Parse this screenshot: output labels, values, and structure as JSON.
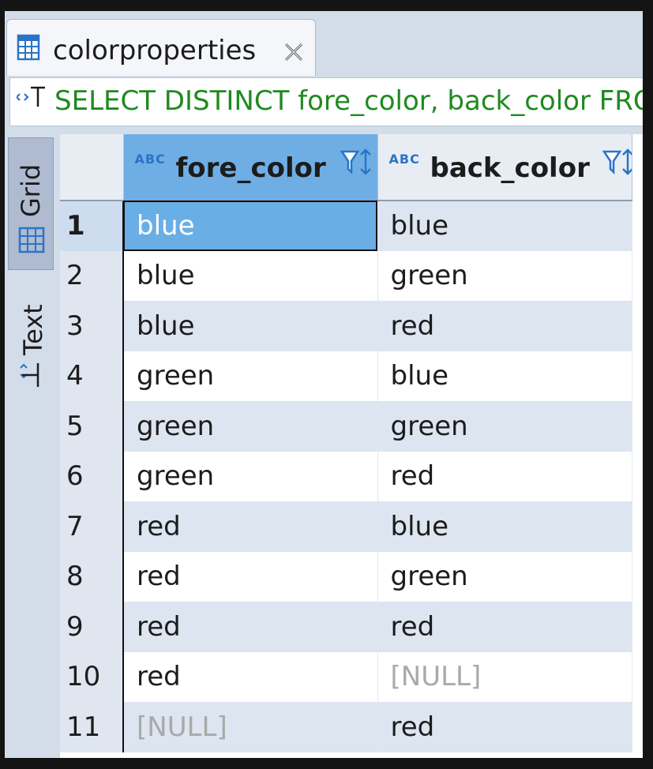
{
  "editor_tab": {
    "title": "colorproperties"
  },
  "query": {
    "sql": "SELECT DISTINCT fore_color, back_color FROM colorproperties"
  },
  "side_tabs": {
    "grid_label": "Grid",
    "text_label": "Text"
  },
  "table": {
    "type_badge": "ABC",
    "columns": [
      "fore_color",
      "back_color"
    ],
    "rows": [
      {
        "num": "1",
        "fore_color": "blue",
        "back_color": "blue"
      },
      {
        "num": "2",
        "fore_color": "blue",
        "back_color": "green"
      },
      {
        "num": "3",
        "fore_color": "blue",
        "back_color": "red"
      },
      {
        "num": "4",
        "fore_color": "green",
        "back_color": "blue"
      },
      {
        "num": "5",
        "fore_color": "green",
        "back_color": "green"
      },
      {
        "num": "6",
        "fore_color": "green",
        "back_color": "red"
      },
      {
        "num": "7",
        "fore_color": "red",
        "back_color": "blue"
      },
      {
        "num": "8",
        "fore_color": "red",
        "back_color": "green"
      },
      {
        "num": "9",
        "fore_color": "red",
        "back_color": "red"
      },
      {
        "num": "10",
        "fore_color": "red",
        "back_color": "[NULL]"
      },
      {
        "num": "11",
        "fore_color": "[NULL]",
        "back_color": "red"
      }
    ]
  },
  "colors": {
    "sql_text": "#1f8a1f",
    "selected_header": "#6faee5",
    "selected_cell": "#6aaee6",
    "null_text": "#a9a9a9",
    "stripe": "#dde5f0"
  }
}
